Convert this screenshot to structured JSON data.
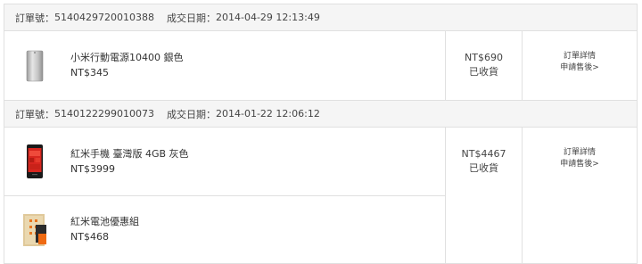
{
  "orders": [
    {
      "order_no_label": "訂單號：",
      "order_no": "5140429720010388",
      "date_label": "成交日期：",
      "date": "2014-04-29 12:13:49",
      "items": [
        {
          "name": "小米行動電源10400 銀色",
          "price": "NT$345",
          "thumb_icon": "power-bank-icon"
        }
      ],
      "total": "NT$690",
      "status": "已收貨",
      "actions": {
        "detail": "訂單詳情",
        "after_sale": "申請售後>"
      }
    },
    {
      "order_no_label": "訂單號：",
      "order_no": "5140122299010073",
      "date_label": "成交日期：",
      "date": "2014-01-22 12:06:12",
      "items": [
        {
          "name": "紅米手機 臺灣版 4GB 灰色",
          "price": "NT$3999",
          "thumb_icon": "phone-icon"
        },
        {
          "name": "紅米電池優惠組",
          "price": "NT$468",
          "thumb_icon": "battery-pack-icon"
        }
      ],
      "total": "NT$4467",
      "status": "已收貨",
      "actions": {
        "detail": "訂單詳情",
        "after_sale": "申請售後>"
      }
    }
  ]
}
